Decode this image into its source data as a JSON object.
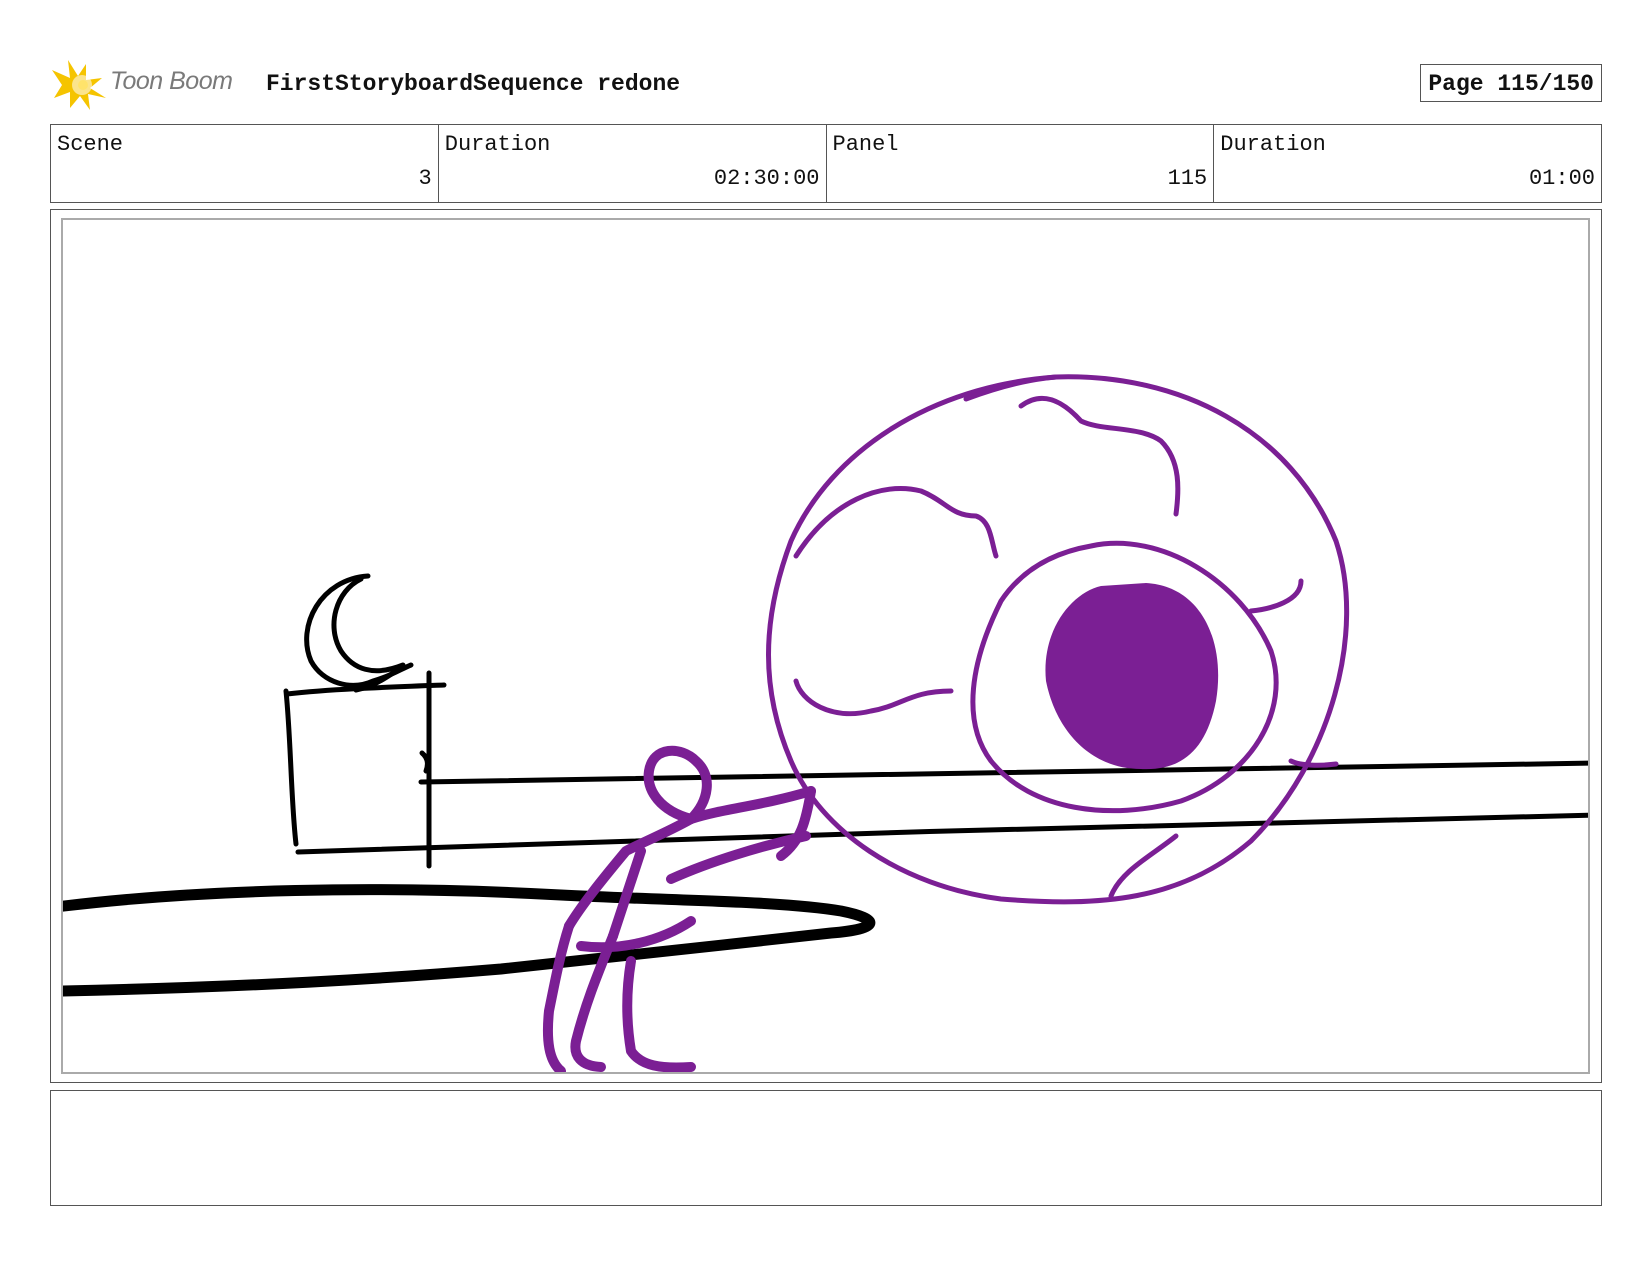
{
  "header": {
    "brand": "Toon Boom",
    "title": "FirstStoryboardSequence redone",
    "page_label": "Page 115/150",
    "logo_icon": "toon-boom-star-logo"
  },
  "info": [
    {
      "label": "Scene",
      "value": "3"
    },
    {
      "label": "Duration",
      "value": "02:30:00"
    },
    {
      "label": "Panel",
      "value": "115"
    },
    {
      "label": "Duration",
      "value": "01:00"
    }
  ],
  "panel": {
    "colors": {
      "ink": "#000000",
      "purple": "#7b1f94",
      "frame": "#aaaaaa"
    }
  },
  "notes": {
    "text": ""
  }
}
